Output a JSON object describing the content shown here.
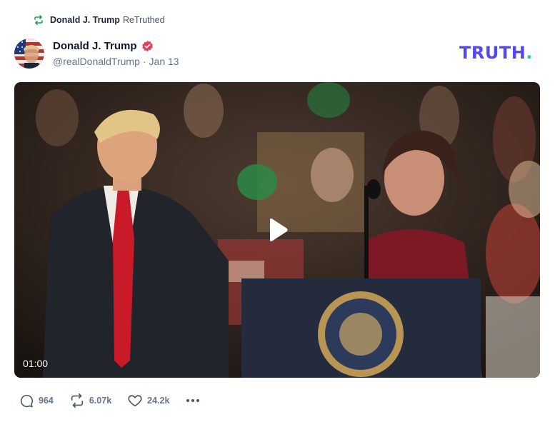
{
  "retruth": {
    "name": "Donald J. Trump",
    "label": "ReTruthed",
    "icon": "retruth-icon"
  },
  "post": {
    "author_name": "Donald J. Trump",
    "verified_icon": "verified-badge-icon",
    "handle": "@realDonaldTrump",
    "separator": "·",
    "date": "Jan 13",
    "video": {
      "duration": "01:00",
      "play_icon": "play-icon"
    }
  },
  "brand": {
    "logo_text": "TRUTH",
    "logo_dot": ".",
    "primary_color": "#5448ee",
    "dot_color": "#17d4a6"
  },
  "actions": {
    "reply": {
      "icon": "reply-bubble-icon",
      "count": "964"
    },
    "retruth": {
      "icon": "retruth-icon",
      "count": "6.07k"
    },
    "like": {
      "icon": "heart-icon",
      "count": "24.2k"
    },
    "more": {
      "icon": "more-dots-icon"
    }
  },
  "colors": {
    "retruth_green": "#16a34a",
    "verified_pink": "#e8415f",
    "muted_text": "#64748b"
  }
}
